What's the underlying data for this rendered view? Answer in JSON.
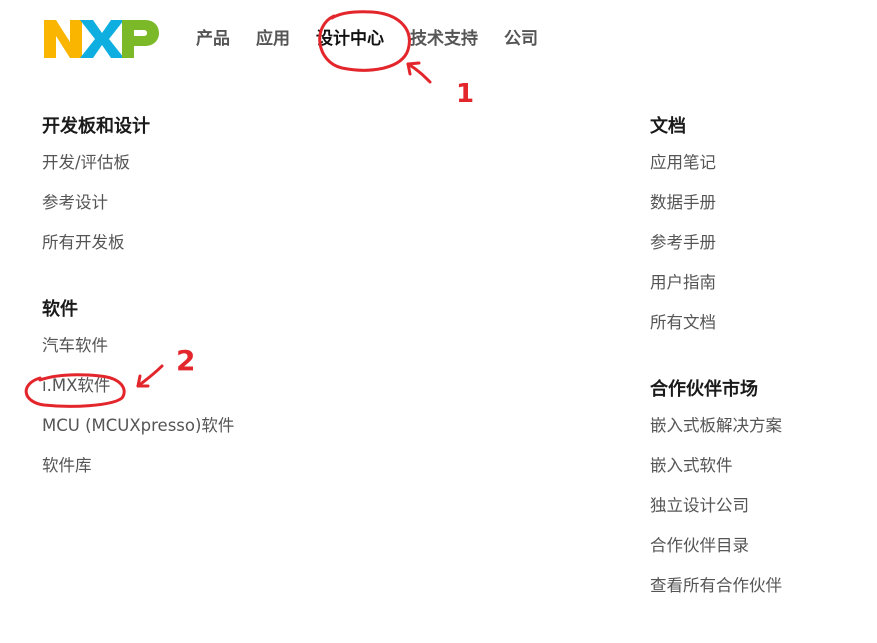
{
  "brand": {
    "logo_text": "NXP",
    "colors": {
      "n": "#F9B500",
      "x": "#0EAFE0",
      "p": "#7BB928"
    }
  },
  "nav": {
    "items": [
      {
        "label": "产品"
      },
      {
        "label": "应用"
      },
      {
        "label": "设计中心"
      },
      {
        "label": "技术支持"
      },
      {
        "label": "公司"
      }
    ]
  },
  "menu": {
    "left": [
      {
        "title": "开发板和设计",
        "links": [
          "开发/评估板",
          "参考设计",
          "所有开发板"
        ]
      },
      {
        "title": "软件",
        "links": [
          "汽车软件",
          "i.MX软件",
          "MCU (MCUXpresso)软件",
          "软件库"
        ]
      }
    ],
    "right": [
      {
        "title": "文档",
        "links": [
          "应用笔记",
          "数据手册",
          "参考手册",
          "用户指南",
          "所有文档"
        ]
      },
      {
        "title": "合作伙伴市场",
        "links": [
          "嵌入式板解决方案",
          "嵌入式软件",
          "独立设计公司",
          "合作伙伴目录",
          "查看所有合作伙伴"
        ]
      }
    ]
  },
  "annotations": {
    "label_1": "1",
    "label_2": "2",
    "color": "#E3262B"
  }
}
